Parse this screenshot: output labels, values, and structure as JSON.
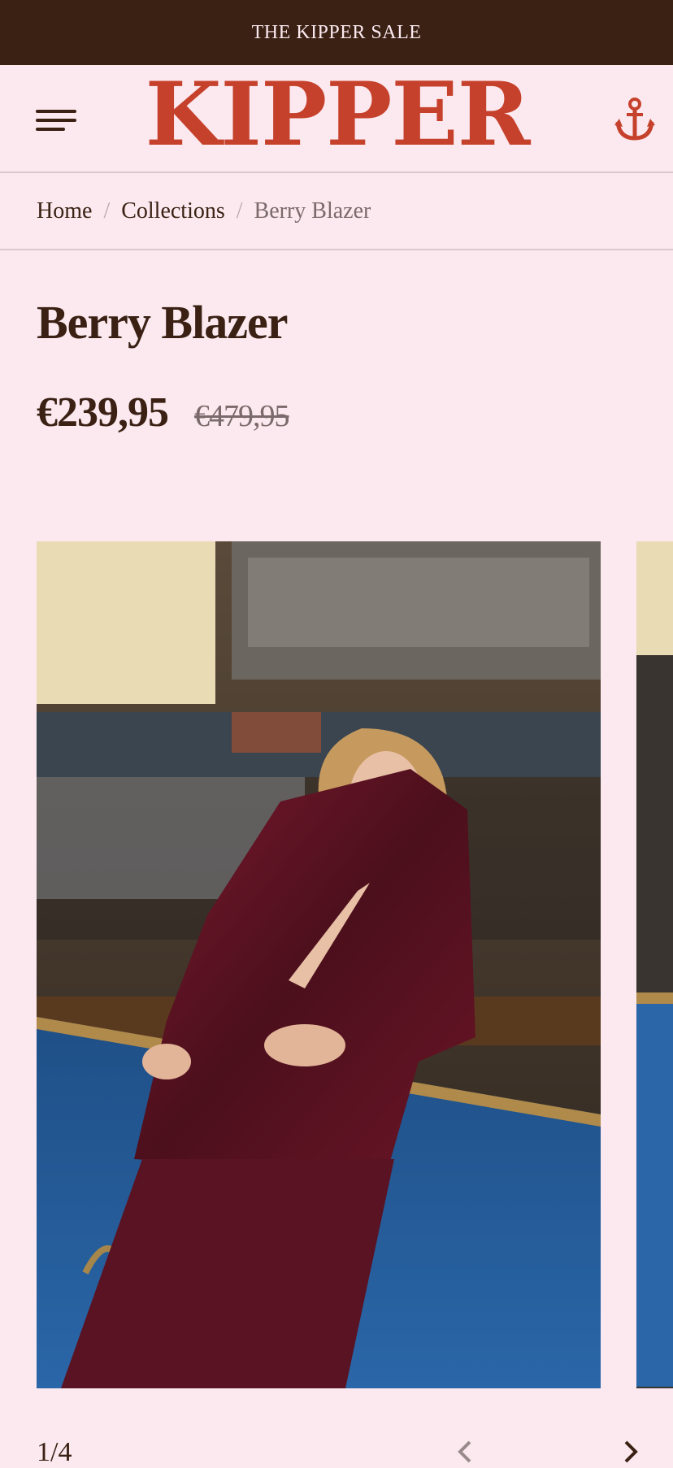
{
  "announcement": {
    "text": "THE KIPPER SALE"
  },
  "header": {
    "logo_text": "KIPPER",
    "menu_icon": "hamburger-menu-icon",
    "anchor_icon": "anchor-icon"
  },
  "breadcrumb": {
    "items": [
      "Home",
      "Collections",
      "Berry Blazer"
    ],
    "separator": "/"
  },
  "product": {
    "title": "Berry Blazer",
    "price_sale": "€239,95",
    "price_original": "€479,95"
  },
  "gallery": {
    "counter": "1/4",
    "prev_icon": "chevron-left-icon",
    "next_icon": "chevron-right-icon"
  },
  "colors": {
    "background": "#fbe9ef",
    "dark_brown": "#3a2114",
    "brand_red": "#c6412c"
  }
}
